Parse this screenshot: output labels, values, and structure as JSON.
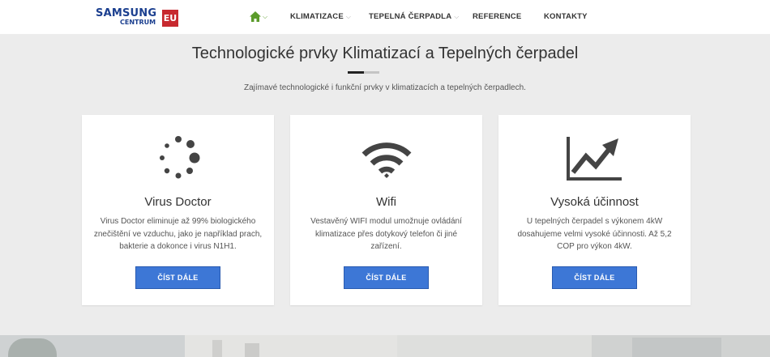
{
  "logo": {
    "brand": "SAMSUNG",
    "sub": "CENTRUM",
    "badge": "EU"
  },
  "nav": {
    "home_icon": "home-icon",
    "items": [
      {
        "label": "KLIMATIZACE",
        "chevron": "⌵"
      },
      {
        "label": "TEPELNÁ ČERPADLA",
        "chevron": "⌵"
      },
      {
        "label": "REFERENCE"
      },
      {
        "label": "KONTAKTY"
      }
    ]
  },
  "section": {
    "title": "Technologické prvky Klimatizací a Tepelných čerpadel",
    "subtitle": "Zajímavé technologické i funkční prvky v klimatizacích a tepelných čerpadlech."
  },
  "cards": [
    {
      "icon": "spinner-icon",
      "title": "Virus Doctor",
      "text": "Virus Doctor eliminuje až 99% biologického znečištění ve vzduchu, jako je například prach, bakterie a dokonce i virus N1H1.",
      "button": "ČÍST DÁLE"
    },
    {
      "icon": "wifi-icon",
      "title": "Wifi",
      "text": "Vestavěný WIFI modul umožnuje ovládání klimatizace přes dotykový telefon či jiné zařízení.",
      "button": "ČÍST DÁLE"
    },
    {
      "icon": "trending-up-chart-icon",
      "title": "Vysoká účinnost",
      "text": "U tepelných čerpadel s výkonem 4kW dosahujeme velmi vysoké účinnosti. Až 5,2 COP pro výkon 4kW.",
      "button": "ČÍST DÁLE"
    }
  ],
  "colors": {
    "accent": "#3d77d6",
    "brand": "#1b3f8f",
    "badge": "#c7292f",
    "home": "#5b9b2b",
    "icon": "#444444"
  }
}
